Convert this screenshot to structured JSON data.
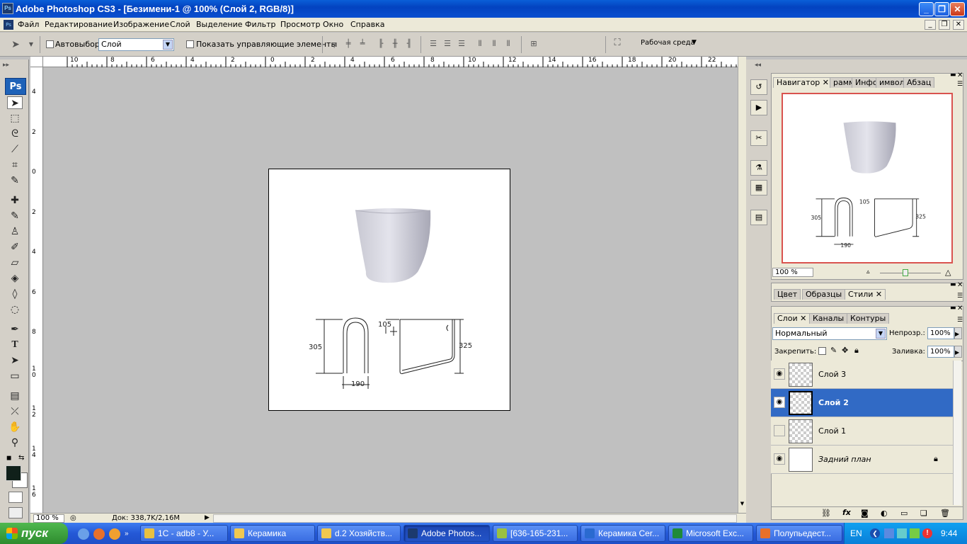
{
  "window": {
    "title": "Adobe Photoshop CS3 - [Безимени-1 @ 100% (Слой 2, RGB/8)]",
    "controls": [
      "_",
      "❐",
      "✕"
    ],
    "app_icon": "Ps"
  },
  "menu": {
    "items": [
      "Файл",
      "Редактирование",
      "Изображение",
      "Слой",
      "Выделение",
      "Фильтр",
      "Просмотр",
      "Окно",
      "Справка"
    ],
    "doc_controls": [
      "_",
      "❐",
      "✕"
    ]
  },
  "options": {
    "autoselect_label": "Автовыбор:",
    "autoselect_value": "Слой",
    "show_controls_label": "Показать управляющие элементы",
    "workspace_label": "Рабочая среда"
  },
  "tools": {
    "logo": "Ps",
    "icons": [
      "move-icon",
      "marquee-icon",
      "lasso-icon",
      "magic-wand-icon",
      "crop-icon",
      "slice-icon",
      "healing-icon",
      "brush-icon",
      "stamp-icon",
      "history-brush-icon",
      "eraser-icon",
      "bucket-icon",
      "blur-icon",
      "dodge-icon",
      "pen-icon",
      "type-icon",
      "path-select-icon",
      "shape-icon",
      "notes-icon",
      "eyedropper-icon",
      "hand-icon",
      "zoom-icon"
    ]
  },
  "rulers": {
    "top": [
      "10",
      "8",
      "6",
      "4",
      "2",
      "0",
      "2",
      "4",
      "6",
      "8",
      "10",
      "12",
      "14",
      "16",
      "18",
      "20",
      "22"
    ],
    "left": [
      "4",
      "2",
      "0",
      "2",
      "4",
      "6",
      "8",
      "1\n0",
      "1\n2",
      "1\n4",
      "1\n6"
    ]
  },
  "canvas": {
    "dims": {
      "d305": "305",
      "d105": "105",
      "d325": "325",
      "d190": "190"
    }
  },
  "status": {
    "zoom": "100 %",
    "doc_size": "Док: 338,7K/2,16M"
  },
  "navigator": {
    "tabs": [
      "Навигатор",
      "рамма",
      "Инфо",
      "имвол",
      "Абзац"
    ],
    "zoom": "100 %",
    "dims": {
      "d305": "305",
      "d105": "105",
      "d325": "325",
      "d190": "190"
    }
  },
  "color_panel": {
    "tabs": [
      "Цвет",
      "Образцы",
      "Стили"
    ]
  },
  "layers_panel": {
    "tabs": [
      "Слои",
      "Каналы",
      "Контуры"
    ],
    "blend_mode": "Нормальный",
    "opacity_label": "Непрозр.:",
    "opacity_value": "100%",
    "lock_label": "Закрепить:",
    "fill_label": "Заливка:",
    "fill_value": "100%",
    "layers": [
      {
        "name": "Слой 3",
        "visible": true,
        "selected": false
      },
      {
        "name": "Слой 2",
        "visible": true,
        "selected": true
      },
      {
        "name": "Слой 1",
        "visible": false,
        "selected": false
      },
      {
        "name": "Задний план",
        "visible": true,
        "selected": false,
        "locked": true
      }
    ],
    "footer_icons": [
      "link-icon",
      "fx-icon",
      "mask-icon",
      "adjustment-icon",
      "group-icon",
      "new-layer-icon",
      "trash-icon"
    ]
  },
  "taskbar": {
    "start": "пуск",
    "items": [
      {
        "label": "1C - adb8 - У...",
        "color": "#e8c040"
      },
      {
        "label": "Керамика",
        "color": "#f0c850"
      },
      {
        "label": "d.2 Хозяйств...",
        "color": "#f0c850"
      },
      {
        "label": "Adobe Photos...",
        "color": "#1c3a6e",
        "active": true
      },
      {
        "label": "[636-165-231...",
        "color": "#9ac040"
      },
      {
        "label": "Керамика Cer...",
        "color": "#2a6ad0"
      },
      {
        "label": "Microsoft Exc...",
        "color": "#1f8a3a"
      },
      {
        "label": "Полупьедест...",
        "color": "#e8702a"
      }
    ],
    "lang": "EN",
    "time": "9:44"
  },
  "colors": {
    "titlebar": "#0a4fd0",
    "selected_layer": "#316ac5",
    "nav_frame": "#d9534f",
    "taskbar": "#2458d6",
    "start": "#2e8b2e"
  }
}
